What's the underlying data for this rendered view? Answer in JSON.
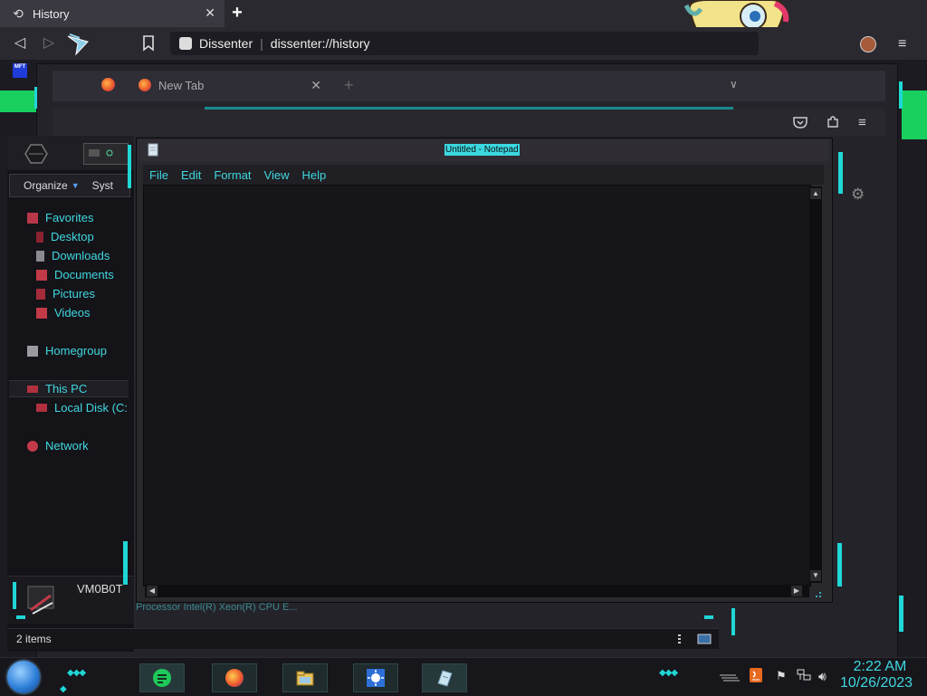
{
  "browser": {
    "tab_title": "History",
    "tab_icon": "history-icon",
    "site_name": "Dissenter",
    "url": "dissenter://history",
    "new_tab_glyph": "+",
    "menu_glyph": "≡"
  },
  "firefox": {
    "tab_label": "New Tab",
    "tab_close": "✕",
    "new_tab_glyph": "+",
    "list_all_glyph": "∨",
    "status_text": "Processor   Intel(R) Xeon(R) CPU E..."
  },
  "explorer": {
    "toolbar": {
      "organize": "Organize",
      "system": "Syst"
    },
    "nav": {
      "favorites": "Favorites",
      "desktop": "Desktop",
      "downloads": "Downloads",
      "documents": "Documents",
      "pictures": "Pictures",
      "videos": "Videos",
      "homegroup": "Homegroup",
      "this_pc": "This PC",
      "local_disk": "Local Disk (C:",
      "network": "Network"
    },
    "computer_name": "VM0B0T",
    "items_count": "2 items"
  },
  "notepad": {
    "title": "Untitled - Notepad",
    "menu": [
      "File",
      "Edit",
      "Format",
      "View",
      "Help"
    ],
    "content": ""
  },
  "taskbar": {
    "clock_time": "2:22 AM",
    "clock_date": "10/26/2023",
    "pinned": [
      "notes-app-icon",
      "firefox-icon",
      "file-explorer-icon",
      "weather-icon",
      "notepad-icon"
    ]
  },
  "colors": {
    "accent_cyan": "#3fd8e0",
    "accent_green": "#19d05e",
    "background": "#1d1b22"
  }
}
